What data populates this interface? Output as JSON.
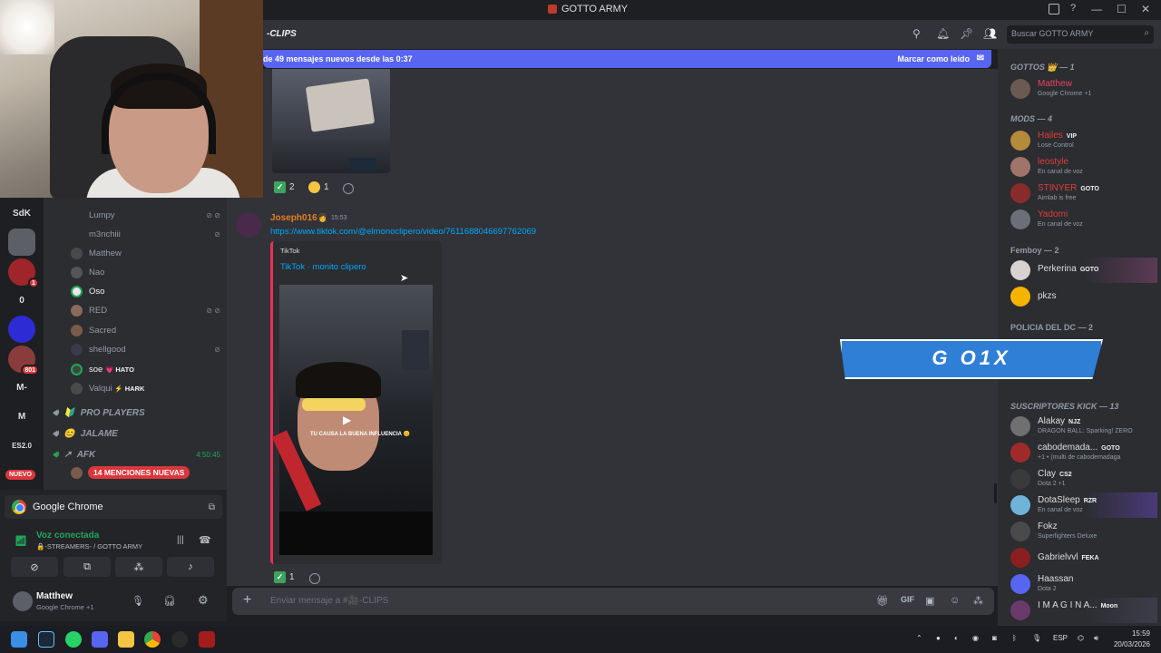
{
  "window": {
    "title": "GOTTO ARMY",
    "controls": [
      "—",
      "☐",
      "✕"
    ]
  },
  "server_list": {
    "items": [
      {
        "label": "SdK",
        "color": "#313338"
      },
      {
        "label": "",
        "color": "#5c5f66"
      },
      {
        "label": "",
        "color": "#a0252b",
        "badge": "1"
      },
      {
        "label": "0",
        "color": "#313338"
      },
      {
        "label": "",
        "color": "#2d2bd6"
      },
      {
        "label": "",
        "color": "#8a3b3b",
        "badge": "801"
      },
      {
        "label": "M-",
        "color": "#313338"
      },
      {
        "label": "M",
        "color": "#313338"
      },
      {
        "label": "ES2.0",
        "color": "#313338"
      }
    ],
    "nuevo_label": "NUEVO"
  },
  "channels": {
    "voice_users": [
      {
        "name": "Lumpy",
        "icons": "⊘ ⊘"
      },
      {
        "name": "m3nchiii",
        "icons": "⊘"
      },
      {
        "name": "Matthew",
        "icons": ""
      },
      {
        "name": "Nao",
        "icons": ""
      },
      {
        "name": "Oso",
        "icons": "",
        "white": true
      },
      {
        "name": "RED",
        "icons": "⊘ ⊘"
      },
      {
        "name": "Sacred",
        "icons": ""
      },
      {
        "name": "shellgood",
        "icons": "⊘"
      },
      {
        "name": "soe",
        "tag": "💗 HATO",
        "icons": "",
        "white": true
      },
      {
        "name": "Valqui",
        "tag": "⚡ HARK",
        "icons": ""
      }
    ],
    "voice_channels": [
      {
        "name": "PRO PLAYERS",
        "prefix": "🔰"
      },
      {
        "name": "JALAME",
        "prefix": "😊"
      },
      {
        "name": "AFK",
        "prefix": "↗",
        "time": "4:50:45"
      }
    ],
    "mentions_label": "14 MENCIONES NUEVAS"
  },
  "voice_panel": {
    "app_name": "Google Chrome",
    "status": "Voz conectada",
    "channel": "🔒-STREAMERS- / GOTTO ARMY",
    "user": {
      "name": "Matthew",
      "activity": "Google Chrome +1"
    }
  },
  "chat": {
    "channel_name": "-CLIPS",
    "new_messages_banner": "de 49 mensajes nuevos desde las 0:37",
    "mark_read": "Marcar como leído",
    "prev_reactions": [
      {
        "kind": "check",
        "count": "2"
      },
      {
        "kind": "emoji",
        "count": "1"
      }
    ],
    "message": {
      "author": "Joseph016",
      "time": "15:53",
      "link": "https://www.tiktok.com/@elmonoclipero/video/7611688046697762069",
      "embed_provider": "TikTok",
      "embed_title": "TikTok · monito clipero",
      "video_caption": "TU CAUSA LA BUENA INFLUENCIA 😊"
    },
    "msg_reactions": [
      {
        "kind": "check",
        "count": "1"
      }
    ],
    "composer_placeholder": "Enviar mensaje a #🎥-CLIPS"
  },
  "members": {
    "search_placeholder": "Buscar GOTTO ARMY",
    "groups": [
      {
        "title": "GOTTOS 👑 — 1",
        "members": [
          {
            "name": "Matthew",
            "status": "Google Chrome +1",
            "color": "#e84560"
          }
        ]
      },
      {
        "title": "MODS — 4",
        "members": [
          {
            "name": "Hailes",
            "badge": "VIP",
            "status": "Lose Control",
            "color": "#e03c3c"
          },
          {
            "name": "leostyle",
            "status": "En canal de voz",
            "color": "#e03c3c"
          },
          {
            "name": "STINYER",
            "badge": "GOTO",
            "status": "Aimlab is free",
            "color": "#e03c3c"
          },
          {
            "name": "Yadomi",
            "status": "En canal de voz",
            "color": "#e03c3c"
          }
        ]
      },
      {
        "title": "Femboy — 2",
        "members": [
          {
            "name": "Perkerina",
            "badge": "GOTO",
            "status": "",
            "color": "#dbdee1"
          },
          {
            "name": "pkzs",
            "status": "",
            "color": "#dbdee1"
          }
        ]
      },
      {
        "title": "POLICIA DEL DC — 2",
        "members": []
      },
      {
        "title": "SUSCRIPTORES KICK — 13",
        "members": [
          {
            "name": "Alakay",
            "badge": "NJZ",
            "status": "DRAGON BALL: Sparking! ZERO",
            "color": "#dbdee1"
          },
          {
            "name": "cabodemada...",
            "badge": "GOTO",
            "status": "+1 • (multi de cabodemadaga",
            "color": "#dbdee1"
          },
          {
            "name": "Clay",
            "badge": "CS2",
            "status": "Dota 2 +1",
            "color": "#dbdee1"
          },
          {
            "name": "DotaSleep",
            "badge": "RZR",
            "status": "En canal de voz",
            "color": "#dbdee1"
          },
          {
            "name": "Fokz",
            "status": "Superfighters Deluxe",
            "color": "#dbdee1"
          },
          {
            "name": "Gabrielvvl",
            "badge": "FEKA",
            "status": "",
            "color": "#dbdee1"
          },
          {
            "name": "Haassan",
            "status": "Dota 2",
            "color": "#dbdee1"
          },
          {
            "name": "I M A G I N A...",
            "badge": "Moon",
            "status": "",
            "color": "#dbdee1"
          }
        ]
      }
    ]
  },
  "overlay": {
    "text": "G   O1X"
  },
  "taskbar": {
    "lang": "ESP",
    "time": "15:59",
    "date": "20/03/2026"
  }
}
